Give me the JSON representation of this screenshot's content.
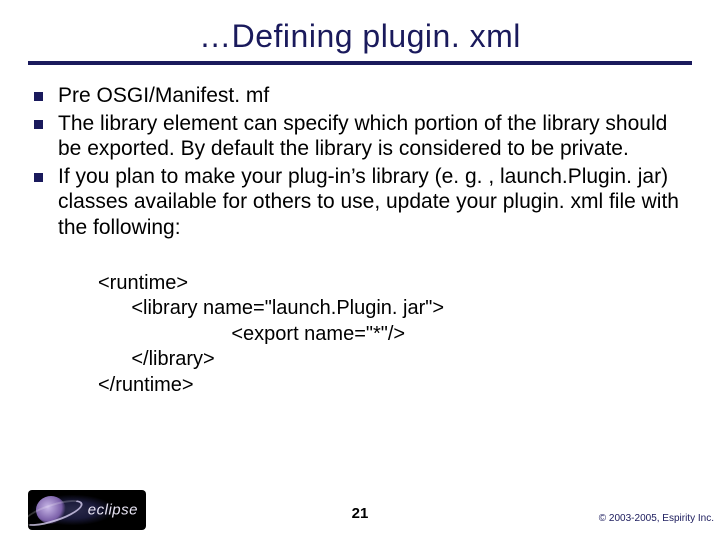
{
  "title": "…Defining plugin. xml",
  "bullets": [
    "Pre OSGI/Manifest. mf",
    "The library element can specify which portion of the library should be exported. By default the library is considered to be private.",
    "If you plan to make your plug-in’s library (e. g. , launch.Plugin. jar) classes available for others to use, update your plugin. xml file with the following:"
  ],
  "code": "<runtime>\n      <library name=\"launch.Plugin. jar\">\n                        <export name=\"*\"/>\n      </library>\n</runtime>",
  "logo_text": "eclipse",
  "page_number": "21",
  "copyright": "© 2003-2005, Espirity Inc."
}
